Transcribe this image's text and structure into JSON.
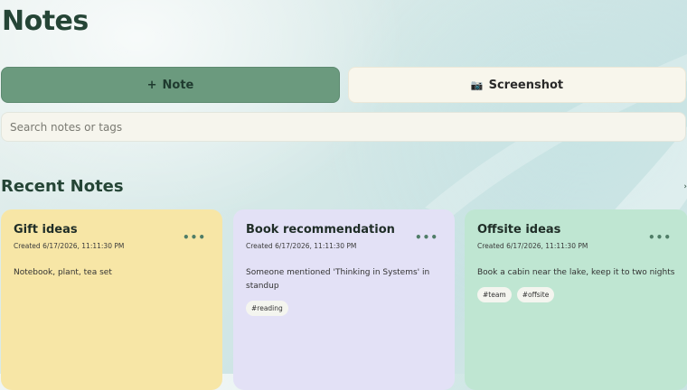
{
  "header": {
    "title": "Notes"
  },
  "toolbar": {
    "note_icon": "+",
    "note_label": "Note",
    "screenshot_icon": "📷",
    "screenshot_label": "Screenshot"
  },
  "search": {
    "placeholder": "Search notes or tags",
    "value": ""
  },
  "recent": {
    "title": "Recent Notes",
    "notes": [
      {
        "title": "Gift ideas",
        "created": "Created 6/17/2026, 11:11:30 PM",
        "body": "Notebook, plant, tea set",
        "tags": [],
        "color": "#f7e6a6"
      },
      {
        "title": "Book recommendation",
        "created": "Created 6/17/2026, 11:11:30 PM",
        "body": "Someone mentioned 'Thinking in Systems' in standup",
        "tags": [
          "#reading"
        ],
        "color": "#e3e1f6"
      },
      {
        "title": "Offsite ideas",
        "created": "Created 6/17/2026, 11:11:30 PM",
        "body": "Book a cabin near the lake, keep it to two nights",
        "tags": [
          "#team",
          "#offsite"
        ],
        "color": "#bfe6d2"
      }
    ]
  },
  "theme": {
    "accent": "#6b9a7e",
    "text": "#254536"
  }
}
